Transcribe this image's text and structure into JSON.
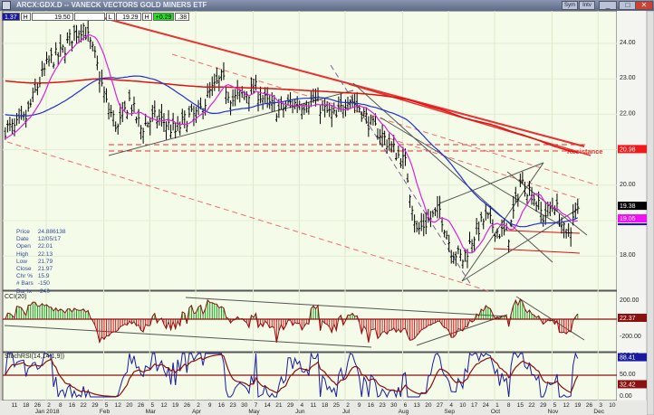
{
  "window": {
    "title": "ARCX:GDX.D -- VANECK VECTORS GOLD MINERS ETF",
    "buttons": [
      "Sym",
      "Intv"
    ],
    "minimize": "_",
    "maximize": "□",
    "close": "✕"
  },
  "toolbar": {
    "first": "1.37",
    "h_label": "H",
    "high": "19.50",
    "blank": "",
    "l_label": "L",
    "low": "19.29",
    "b_label": "H",
    "change": "+0.29",
    "last": ".38"
  },
  "info_box": [
    {
      "k": "Price",
      "v": "24.886138"
    },
    {
      "k": "Date",
      "v": "12/05/17"
    },
    {
      "k": "Open",
      "v": "22.01"
    },
    {
      "k": "High",
      "v": "22.13"
    },
    {
      "k": "Low",
      "v": "21.79"
    },
    {
      "k": "Close",
      "v": "21.97"
    },
    {
      "k": "Chr %",
      "v": "15.9"
    },
    {
      "k": "# Bars",
      "v": "-150"
    },
    {
      "k": "Bar Ix",
      "v": "-240"
    }
  ],
  "colors": {
    "background": "#f4fbe8",
    "price_bars": "#000000",
    "ma_fast": "#e020e0",
    "ma_mid": "#2030d0",
    "ma_slow": "#e01010",
    "trendline": "#555555",
    "resistance": "#e83030",
    "cci_up": "#10a010",
    "cci_down": "#e01010",
    "stoch": "#1a1aa0",
    "stoch_signal": "#8b1010"
  },
  "chart_data": [
    {
      "panel": "price",
      "type": "ohlc",
      "symbol": "ARCX:GDX.D",
      "y_ticks": [
        "24.00",
        "23.00",
        "22.00",
        "20.00",
        "18.00"
      ],
      "ylim": [
        17.1,
        25.0
      ],
      "resistance_label": "Resistance",
      "resistance_value": "20.98",
      "last_price": "19.38",
      "ma_value": "19.05",
      "weekly_close": [
        21.6,
        21.9,
        22.8,
        23.5,
        23.7,
        24.2,
        24.5,
        23.6,
        22.3,
        21.6,
        22.4,
        21.6,
        21.9,
        21.8,
        21.5,
        21.9,
        22.0,
        22.6,
        23.0,
        22.4,
        22.6,
        22.7,
        22.3,
        22.1,
        22.3,
        22.3,
        22.4,
        22.1,
        21.9,
        22.5,
        22.2,
        21.7,
        21.4,
        21.0,
        20.6,
        18.7,
        19.0,
        19.3,
        18.2,
        17.9,
        18.6,
        19.1,
        18.7,
        18.6,
        20.1,
        19.8,
        19.1,
        19.5,
        18.5,
        19.38
      ]
    },
    {
      "panel": "cci",
      "type": "histogram",
      "label": "CCI(20)",
      "y_ticks": [
        "200.00",
        "-200.00"
      ],
      "ylim": [
        -320,
        380
      ],
      "last_value": "22.37"
    },
    {
      "panel": "stochrsi",
      "type": "line",
      "label": "StochRSI(14,14(1,9))",
      "y_ticks": [
        "100.00",
        "50.00",
        "0.00"
      ],
      "ylim": [
        0,
        100
      ],
      "last_value": "88.41",
      "signal_value": "32.42"
    }
  ],
  "x_axis": {
    "day_labels": [
      "11",
      "18",
      "26",
      "2",
      "8",
      "16",
      "22",
      "29",
      "5",
      "12",
      "20",
      "26",
      "5",
      "12",
      "19",
      "26",
      "2",
      "9",
      "16",
      "23",
      "30",
      "7",
      "14",
      "21",
      "29",
      "4",
      "11",
      "18",
      "25",
      "2",
      "9",
      "16",
      "23",
      "30",
      "6",
      "13",
      "20",
      "27",
      "4",
      "10",
      "17",
      "24",
      "1",
      "8",
      "15",
      "22",
      "29",
      "5",
      "12",
      "19",
      "26",
      "3",
      "10"
    ],
    "month_labels": [
      {
        "label": "Jan 2018",
        "week": 3
      },
      {
        "label": "Feb",
        "week": 8
      },
      {
        "label": "Mar",
        "week": 12
      },
      {
        "label": "Apr",
        "week": 16
      },
      {
        "label": "May",
        "week": 21
      },
      {
        "label": "Jun",
        "week": 25
      },
      {
        "label": "Jul",
        "week": 29
      },
      {
        "label": "Aug",
        "week": 34
      },
      {
        "label": "Sep",
        "week": 38
      },
      {
        "label": "Oct",
        "week": 42
      },
      {
        "label": "Nov",
        "week": 47
      },
      {
        "label": "Dec",
        "week": 51
      }
    ]
  }
}
